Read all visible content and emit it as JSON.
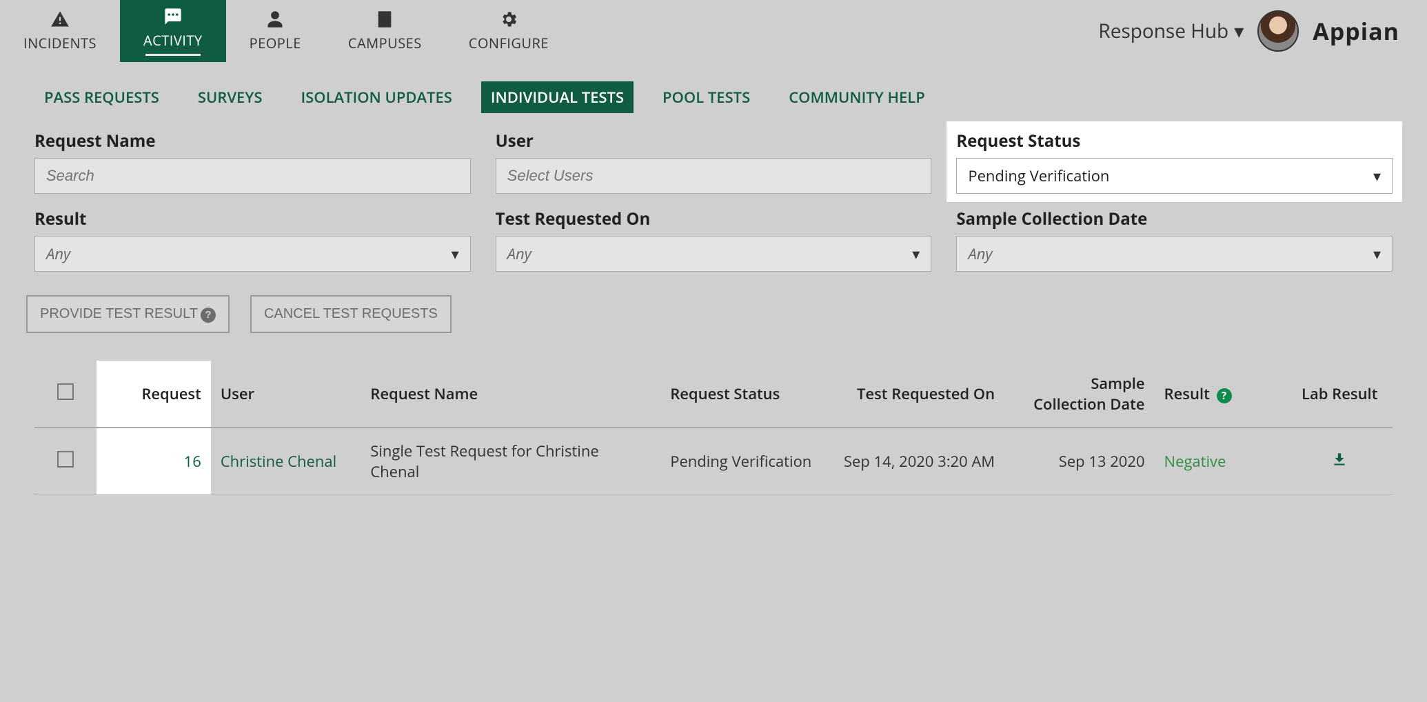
{
  "top_nav": {
    "items": [
      {
        "label": "INCIDENTS",
        "icon": "warning"
      },
      {
        "label": "ACTIVITY",
        "icon": "chat",
        "active": true
      },
      {
        "label": "PEOPLE",
        "icon": "person"
      },
      {
        "label": "CAMPUSES",
        "icon": "building"
      },
      {
        "label": "CONFIGURE",
        "icon": "gear"
      }
    ],
    "hub_label": "Response Hub",
    "brand": "Appian"
  },
  "sub_tabs": [
    {
      "label": "PASS REQUESTS"
    },
    {
      "label": "SURVEYS"
    },
    {
      "label": "ISOLATION UPDATES"
    },
    {
      "label": "INDIVIDUAL TESTS",
      "active": true
    },
    {
      "label": "POOL TESTS"
    },
    {
      "label": "COMMUNITY HELP"
    }
  ],
  "filters": {
    "request_name": {
      "label": "Request Name",
      "placeholder": "Search"
    },
    "user": {
      "label": "User",
      "placeholder": "Select Users"
    },
    "request_status": {
      "label": "Request Status",
      "value": "Pending Verification"
    },
    "result": {
      "label": "Result",
      "value": "Any"
    },
    "test_requested_on": {
      "label": "Test Requested On",
      "value": "Any"
    },
    "sample_collection_date": {
      "label": "Sample Collection Date",
      "value": "Any"
    }
  },
  "actions": {
    "provide_test_result": "PROVIDE TEST RESULT",
    "cancel_test_requests": "CANCEL TEST REQUESTS"
  },
  "table": {
    "headers": {
      "request": "Request",
      "user": "User",
      "request_name": "Request Name",
      "request_status": "Request Status",
      "test_requested_on": "Test Requested On",
      "sample_collection_date": "Sample Collection Date",
      "result": "Result",
      "lab_result": "Lab Result"
    },
    "rows": [
      {
        "request": "16",
        "user": "Christine Chenal",
        "request_name": "Single Test Request for Christine Chenal",
        "request_status": "Pending Verification",
        "test_requested_on": "Sep 14, 2020 3:20 AM",
        "sample_collection_date": "Sep 13 2020",
        "result": "Negative"
      }
    ]
  }
}
